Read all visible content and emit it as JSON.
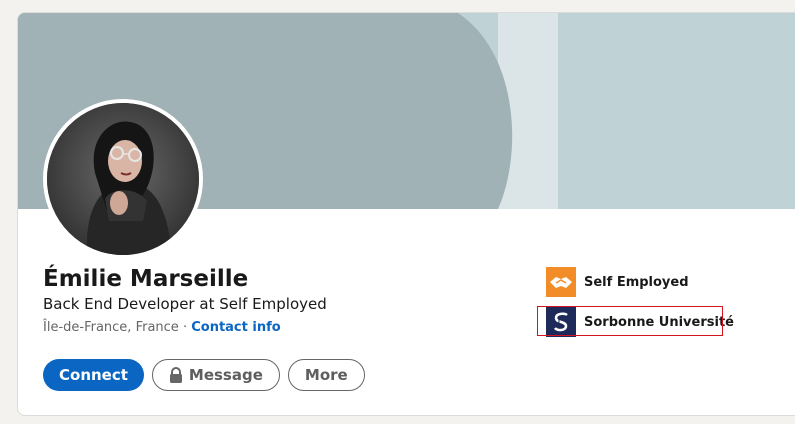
{
  "profile": {
    "name": "Émilie Marseille",
    "headline": "Back End Developer at Self Employed",
    "location": "Île-de-France, France",
    "separator": "·",
    "contact_info": "Contact info"
  },
  "actions": {
    "connect": "Connect",
    "message": "Message",
    "more": "More"
  },
  "orgs": [
    {
      "name": "Self Employed",
      "icon": "handshake-icon",
      "color": "#f28c28"
    },
    {
      "name": "Sorbonne Université",
      "icon": "sorbonne-logo",
      "color": "#1d2a5a"
    }
  ],
  "colors": {
    "accent": "#0a66c2",
    "banner": "#bfd2d6",
    "highlight": "#d4141f"
  }
}
